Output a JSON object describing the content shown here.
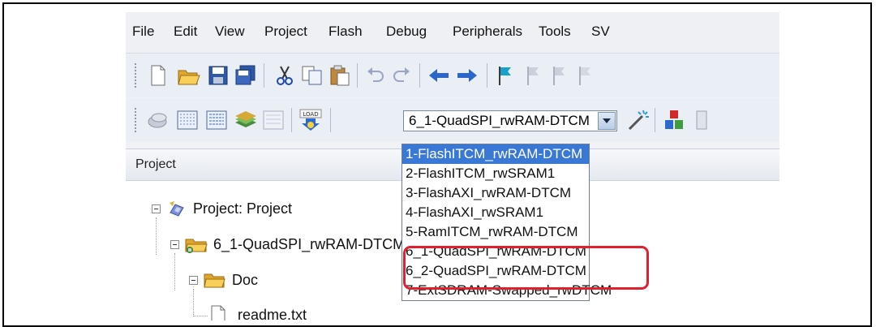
{
  "menu": [
    "File",
    "Edit",
    "View",
    "Project",
    "Flash",
    "Debug",
    "Peripherals",
    "Tools",
    "SV"
  ],
  "toolbar": {
    "target_selected": "6_1-QuadSPI_rwRAM-DTCM",
    "load_label": "LOAD"
  },
  "panel": {
    "title": "Project"
  },
  "tree": {
    "root": "Project: Project",
    "target": "6_1-QuadSPI_rwRAM-DTCM",
    "folder": "Doc",
    "file": "readme.txt"
  },
  "dropdown": {
    "items": [
      "1-FlashITCM_rwRAM-DTCM",
      "2-FlashITCM_rwSRAM1",
      "3-FlashAXI_rwRAM-DTCM",
      "4-FlashAXI_rwSRAM1",
      "5-RamITCM_rwRAM-DTCM",
      "6_1-QuadSPI_rwRAM-DTCM",
      "6_2-QuadSPI_rwRAM-DTCM",
      "7-ExtSDRAM-Swapped_rwDTCM"
    ],
    "selected_index": 0
  },
  "colors": {
    "highlight": "#e0202d",
    "selection": "#3a78d6"
  }
}
